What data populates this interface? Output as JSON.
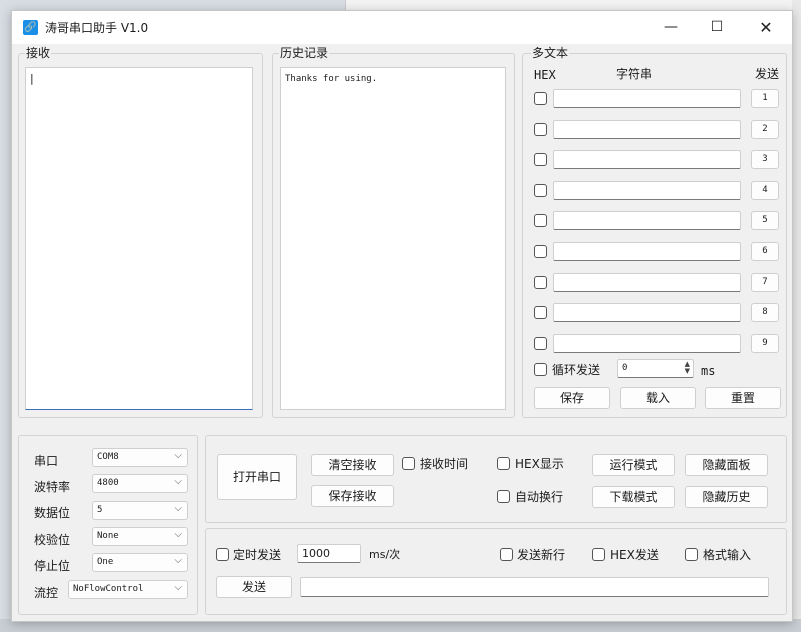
{
  "window": {
    "title": "涛哥串口助手 V1.0",
    "icon": "link-icon"
  },
  "receive": {
    "group_label": "接收",
    "text": "|"
  },
  "history": {
    "group_label": "历史记录",
    "text": "Thanks for using."
  },
  "multi": {
    "group_label": "多文本",
    "col_hex": "HEX",
    "col_string": "字符串",
    "col_send": "发送",
    "rows": [
      "1",
      "2",
      "3",
      "4",
      "5",
      "6",
      "7",
      "8",
      "9"
    ],
    "loop_label": "循环发送",
    "loop_value": "0",
    "loop_unit": "ms",
    "save": "保存",
    "load": "载入",
    "reset": "重置"
  },
  "serial": {
    "port_label": "串口",
    "port_value": "COM8",
    "baud_label": "波特率",
    "baud_value": "4800",
    "data_label": "数据位",
    "data_value": "5",
    "parity_label": "校验位",
    "parity_value": "None",
    "stop_label": "停止位",
    "stop_value": "One",
    "flow_label": "流控",
    "flow_value": "NoFlowControl"
  },
  "controls": {
    "open_port": "打开串口",
    "clear_rx": "清空接收",
    "save_rx": "保存接收",
    "rx_time": "接收时间",
    "hex_display": "HEX显示",
    "auto_wrap": "自动换行",
    "run_mode": "运行模式",
    "download_mode": "下载模式",
    "hide_panel": "隐藏面板",
    "hide_history": "隐藏历史"
  },
  "send": {
    "timed_label": "定时发送",
    "timed_value": "1000",
    "timed_unit": "ms/次",
    "newline_label": "发送新行",
    "hex_send_label": "HEX发送",
    "format_label": "格式输入",
    "send_button": "发送",
    "send_text": ""
  }
}
